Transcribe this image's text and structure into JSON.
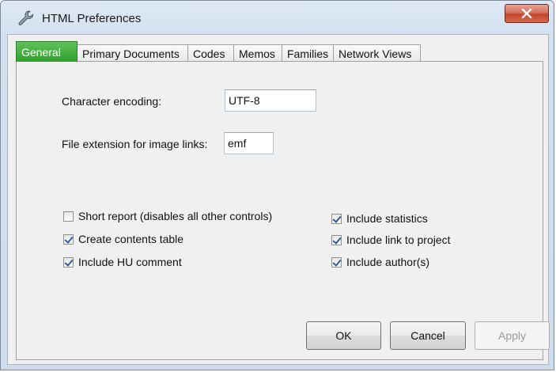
{
  "window": {
    "title": "HTML Preferences",
    "icon": "wrench-icon",
    "close_icon": "close-icon"
  },
  "tabs": [
    {
      "label": "General",
      "active": true
    },
    {
      "label": "Primary Documents",
      "active": false
    },
    {
      "label": "Codes",
      "active": false
    },
    {
      "label": "Memos",
      "active": false
    },
    {
      "label": "Families",
      "active": false
    },
    {
      "label": "Network Views",
      "active": false
    }
  ],
  "fields": {
    "encoding_label": "Character encoding:",
    "encoding_value": "UTF-8",
    "extension_label": "File extension for image links:",
    "extension_value": "emf"
  },
  "options": {
    "short_report": {
      "label": "Short report (disables all other controls)",
      "checked": false
    },
    "contents_table": {
      "label": "Create contents table",
      "checked": true
    },
    "hu_comment": {
      "label": "Include HU comment",
      "checked": true
    },
    "statistics": {
      "label": "Include statistics",
      "checked": true
    },
    "link_project": {
      "label": "Include link to project",
      "checked": true
    },
    "authors": {
      "label": "Include author(s)",
      "checked": true
    }
  },
  "buttons": {
    "ok": "OK",
    "cancel": "Cancel",
    "apply": "Apply"
  },
  "colors": {
    "active_tab": "#3aab36",
    "close_button": "#c9503a"
  }
}
